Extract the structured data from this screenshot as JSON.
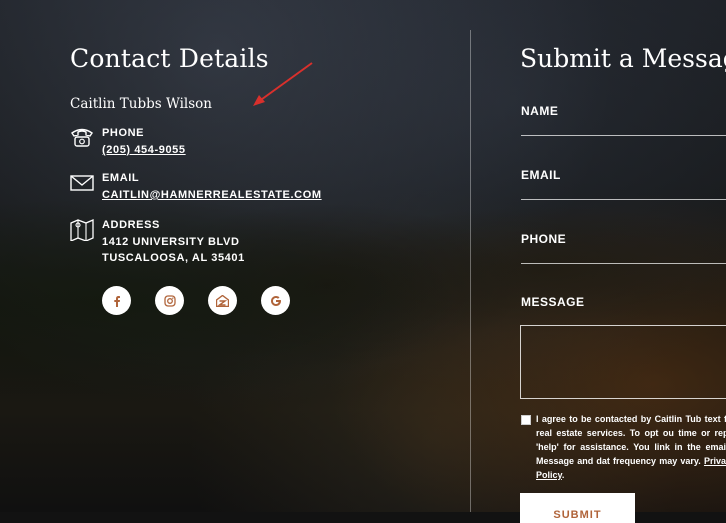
{
  "contact": {
    "title": "Contact Details",
    "agent_name": "Caitlin Tubbs Wilson",
    "phone_label": "PHONE",
    "phone_value": "(205) 454-9055",
    "email_label": "EMAIL",
    "email_value": "CAITLIN@HAMNERREALESTATE.COM",
    "address_label": "ADDRESS",
    "address_line1": "1412 UNIVERSITY BLVD",
    "address_line2": "TUSCALOOSA, AL 35401",
    "social": [
      {
        "icon": "facebook-icon"
      },
      {
        "icon": "instagram-icon"
      },
      {
        "icon": "zillow-icon"
      },
      {
        "icon": "google-icon"
      }
    ]
  },
  "form": {
    "title": "Submit a Message",
    "name_label": "NAME",
    "email_label": "EMAIL",
    "phone_label": "PHONE",
    "message_label": "MESSAGE",
    "consent_text": "I agree to be contacted by Caitlin Tub text for real estate services. To opt ou time or reply 'help' for assistance. You link in the emails. Message and dat frequency may vary.",
    "privacy_link": "Privacy Policy",
    "submit_label": "SUBMIT"
  },
  "colors": {
    "accent": "#b0643a",
    "annotation_arrow": "#d9302c"
  }
}
